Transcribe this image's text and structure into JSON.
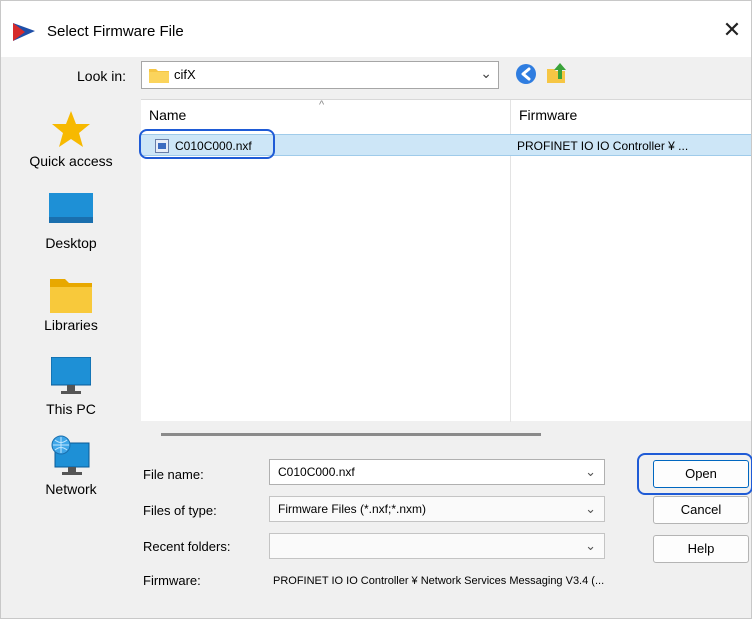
{
  "window": {
    "title": "Select Firmware File",
    "close_glyph": "✕"
  },
  "lookin": {
    "label": "Look in:",
    "value": "cifX"
  },
  "places": [
    {
      "label": "Quick access",
      "icon": "star-icon"
    },
    {
      "label": "Desktop",
      "icon": "desktop-icon"
    },
    {
      "label": "Libraries",
      "icon": "folder-icon"
    },
    {
      "label": "This PC",
      "icon": "monitor-icon"
    },
    {
      "label": "Network",
      "icon": "network-icon"
    }
  ],
  "filelist": {
    "columns": [
      "Name",
      "Firmware"
    ],
    "rows": [
      {
        "name": "C010C000.nxf",
        "firmware": "PROFINET IO IO Controller ¥ ..."
      }
    ]
  },
  "form": {
    "filename_label": "File name:",
    "filename_value": "C010C000.nxf",
    "filetype_label": "Files of type:",
    "filetype_value": "Firmware Files (*.nxf;*.nxm)",
    "recent_label": "Recent folders:",
    "recent_value": "",
    "firmware_label": "Firmware:",
    "firmware_value": "PROFINET IO IO Controller ¥ Network Services Messaging V3.4 (..."
  },
  "buttons": {
    "open": "Open",
    "cancel": "Cancel",
    "help": "Help"
  },
  "colors": {
    "selection": "#cde6f7",
    "highlight": "#1f5bd6",
    "folder": "#f6c644"
  }
}
